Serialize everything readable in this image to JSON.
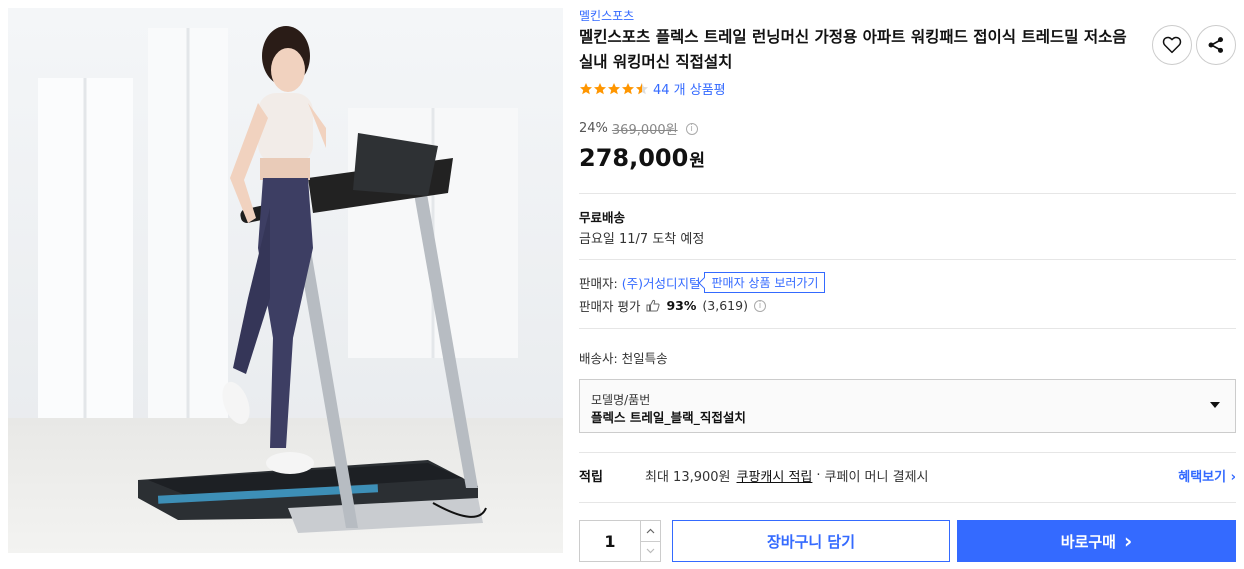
{
  "product": {
    "brand": "멜킨스포츠",
    "title": "멜킨스포츠 플렉스 트레일 런닝머신 가정용 아파트 워킹패드 접이식 트레드밀 저소음 실내 워킹머신 직접설치",
    "image_alt": "treadmill-product-photo",
    "rating_stars": 4.5,
    "review_count": "44 개 상품평"
  },
  "pricing": {
    "discount": "24%",
    "original_price": "369,000원",
    "price": "278,000",
    "price_unit": "원"
  },
  "shipping": {
    "title": "무료배송",
    "arrival": "금요일 11/7 도착 예정"
  },
  "seller": {
    "label": "판매자:",
    "name": "(주)거성디지털",
    "view_products_button": "판매자 상품 보러가기",
    "rating_label": "판매자 평가",
    "rating_percent": "93%",
    "rating_count": "(3,619)"
  },
  "courier": {
    "text": "배송사:  천일특송"
  },
  "option": {
    "label": "모델명/품번",
    "selected": "플렉스 트레일_블랙_직접설치"
  },
  "reward": {
    "label": "적립",
    "text": "최대 13,900원",
    "cash_link": "쿠팡캐시 적립",
    "suffix": "쿠페이 머니 결제시",
    "more": "혜택보기 ›"
  },
  "purchase": {
    "quantity": "1",
    "cart_button": "장바구니 담기",
    "buy_button": "바로구매",
    "buy_arrow": "›"
  },
  "colors": {
    "accent": "#346aff",
    "star": "#ff9600"
  },
  "icons": {
    "wishlist": "heart-icon",
    "share": "share-icon",
    "info": "info-icon",
    "thumb": "thumbs-up-icon",
    "caret": "caret-down-icon"
  }
}
